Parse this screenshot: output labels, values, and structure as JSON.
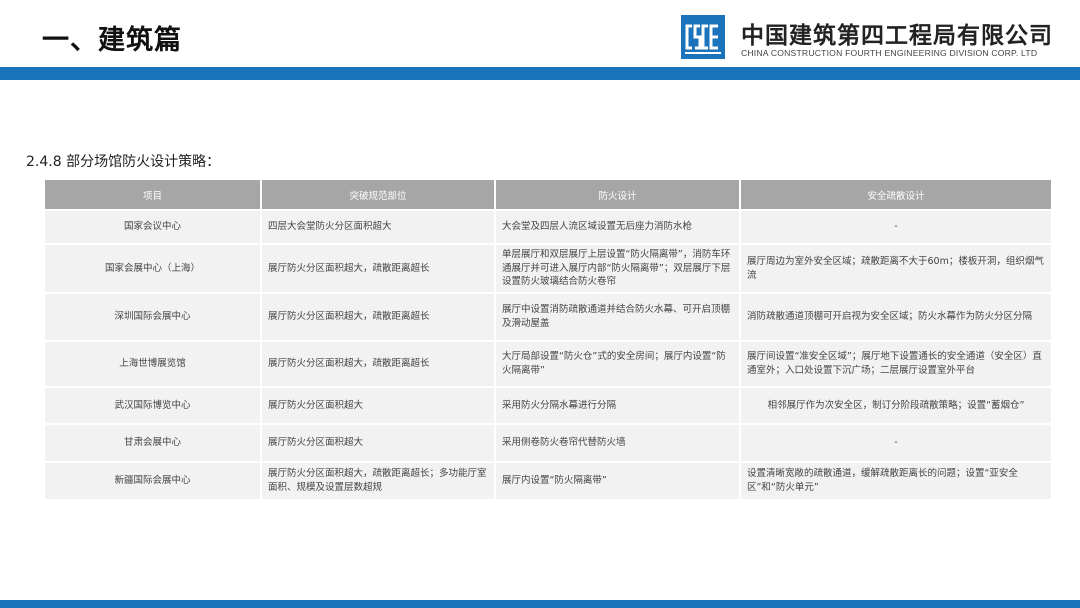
{
  "header": {
    "page_title": "一、建筑篇",
    "company_name": "中国建筑第四工程局有限公司",
    "company_name_en": "CHINA CONSTRUCTION FOURTH ENGINEERING DIVISION CORP. LTD",
    "brand_color": "#1a73bb",
    "logo_icon": "cscec-logo-icon"
  },
  "section": {
    "heading": "2.4.8 部分场馆防火设计策略："
  },
  "table": {
    "headers": [
      "项目",
      "突破规范部位",
      "防火设计",
      "安全疏散设计"
    ],
    "rows": [
      [
        "国家会议中心",
        "四层大会堂防火分区面积超大",
        "大会堂及四层人流区域设置无后座力消防水枪",
        "-"
      ],
      [
        "国家会展中心（上海）",
        "展厅防火分区面积超大，疏散距离超长",
        "单层展厅和双层展厅上层设置“防火隔离带”，消防车环通展厅并可进入展厅内部“防火隔离带”；双层展厅下层设置防火玻璃结合防火卷帘",
        "展厅周边为室外安全区域；疏散距离不大于60m；楼板开洞，组织烟气流"
      ],
      [
        "深圳国际会展中心",
        "展厅防火分区面积超大，疏散距离超长",
        "展厅中设置消防疏散通道并结合防火水幕、可开启顶棚及滑动屋盖",
        "消防疏散通道顶棚可开启视为安全区域；防火水幕作为防火分区分隔"
      ],
      [
        "上海世博展览馆",
        "展厅防火分区面积超大，疏散距离超长",
        "大厅局部设置“防火仓”式的安全房间；展厅内设置“防火隔离带”",
        "展厅间设置“准安全区域”；展厅地下设置通长的安全通道（安全区）直通室外；入口处设置下沉广场；二层展厅设置室外平台"
      ],
      [
        "武汉国际博览中心",
        "展厅防火分区面积超大",
        "采用防火分隔水幕进行分隔",
        "相邻展厅作为次安全区，制订分阶段疏散策略；设置“蓄烟仓”"
      ],
      [
        "甘肃会展中心",
        "展厅防火分区面积超大",
        "采用侧卷防火卷帘代替防火墙",
        "-"
      ],
      [
        "新疆国际会展中心",
        "展厅防火分区面积超大，疏散距离超长；多功能厅室面积、规模及设置层数超规",
        "展厅内设置“防火隔离带”",
        "设置清晰宽敞的疏散通道，缓解疏散距离长的问题；设置“亚安全区”和“防火单元”"
      ]
    ]
  }
}
